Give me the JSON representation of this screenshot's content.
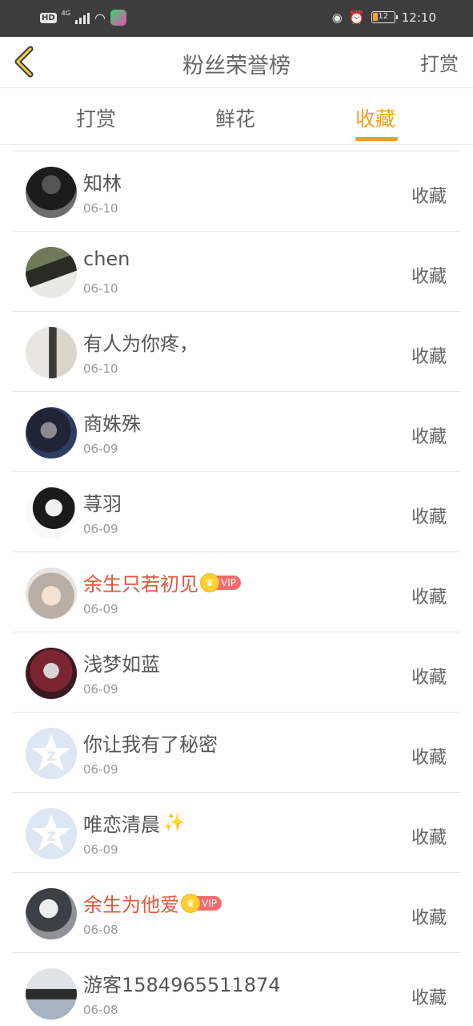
{
  "status_bar": {
    "hd": "HD",
    "network": "4G",
    "time": "12:10",
    "battery": "12"
  },
  "header": {
    "title": "粉丝荣誉榜",
    "right_action": "打赏"
  },
  "tabs": [
    {
      "label": "打赏",
      "active": false
    },
    {
      "label": "鲜花",
      "active": false
    },
    {
      "label": "收藏",
      "active": true
    }
  ],
  "colors": {
    "accent": "#f0a020",
    "vip_name": "#e5543c"
  },
  "list": [
    {
      "name": "知林",
      "date": "06-10",
      "action": "收藏",
      "vip": false,
      "avatar": "photo"
    },
    {
      "name": "chen",
      "date": "06-10",
      "action": "收藏",
      "vip": false,
      "avatar": "photo"
    },
    {
      "name": "有人为你疼，",
      "date": "06-10",
      "action": "收藏",
      "vip": false,
      "avatar": "photo"
    },
    {
      "name": "商姝殊",
      "date": "06-09",
      "action": "收藏",
      "vip": false,
      "avatar": "photo"
    },
    {
      "name": "荨羽",
      "date": "06-09",
      "action": "收藏",
      "vip": false,
      "avatar": "photo"
    },
    {
      "name": "余生只若初见",
      "date": "06-09",
      "action": "收藏",
      "vip": true,
      "vip_label": "VIP",
      "avatar": "photo"
    },
    {
      "name": "浅梦如蓝",
      "date": "06-09",
      "action": "收藏",
      "vip": false,
      "avatar": "photo"
    },
    {
      "name": "你让我有了秘密",
      "date": "06-09",
      "action": "收藏",
      "vip": false,
      "avatar": "default-star-icon"
    },
    {
      "name": "唯恋清晨",
      "date": "06-09",
      "action": "收藏",
      "vip": false,
      "avatar": "default-star-icon",
      "emoji": "✨"
    },
    {
      "name": "余生为他爱",
      "date": "06-08",
      "action": "收藏",
      "vip": true,
      "vip_label": "VIP",
      "avatar": "photo"
    },
    {
      "name": "游客1584965511874",
      "date": "06-08",
      "action": "收藏",
      "vip": false,
      "avatar": "photo"
    }
  ]
}
